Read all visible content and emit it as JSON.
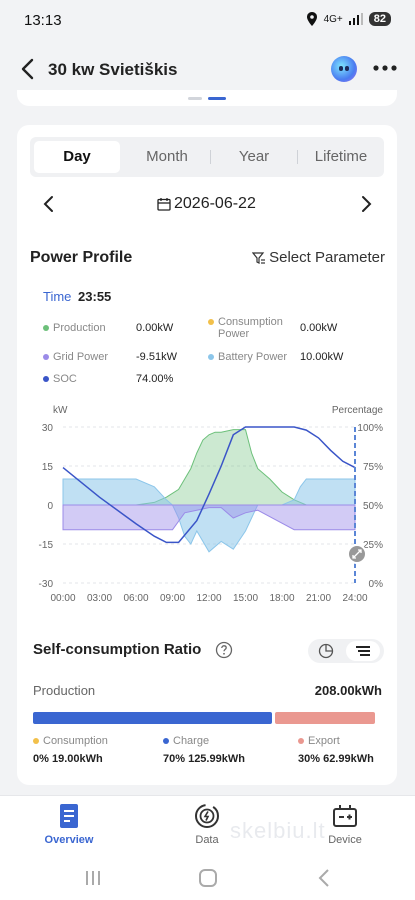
{
  "status_bar": {
    "time": "13:13",
    "network": "4G+",
    "battery": "82"
  },
  "header": {
    "title": "30 kw Svietiškis"
  },
  "tabs": [
    {
      "label": "Day",
      "active": true
    },
    {
      "label": "Month",
      "active": false
    },
    {
      "label": "Year",
      "active": false
    },
    {
      "label": "Lifetime",
      "active": false
    }
  ],
  "date": "2026-06-22",
  "power_profile": {
    "title": "Power Profile",
    "select_parameter": "Select Parameter",
    "time_label": "Time",
    "time_value": "23:55",
    "readouts": [
      {
        "label": "Production",
        "value": "0.00kW",
        "color": "#6cc07a"
      },
      {
        "label": "Consumption Power",
        "value": "0.00kW",
        "color": "#f2c04a"
      },
      {
        "label": "Grid Power",
        "value": "-9.51kW",
        "color": "#9b8be8"
      },
      {
        "label": "Battery Power",
        "value": "10.00kW",
        "color": "#8cc6ea"
      },
      {
        "label": "SOC",
        "value": "74.00%",
        "color": "#3a55c8"
      }
    ]
  },
  "chart_data": {
    "type": "area",
    "y_left_label": "kW",
    "y_right_label": "Percentage",
    "y_left_ticks": [
      "30",
      "15",
      "0",
      "-15",
      "-30"
    ],
    "y_right_ticks": [
      "100%",
      "75%",
      "50%",
      "25%",
      "0%"
    ],
    "ylim_left": [
      -30,
      30
    ],
    "ylim_right": [
      0,
      100
    ],
    "x_ticks": [
      "00:00",
      "03:00",
      "06:00",
      "09:00",
      "12:00",
      "15:00",
      "18:00",
      "21:00",
      "24:00"
    ],
    "grid": true,
    "series": [
      {
        "name": "Production",
        "color": "#6cc07a",
        "x": [
          0,
          6,
          7.5,
          8.5,
          9.5,
          10,
          10.5,
          11,
          11.5,
          12,
          12.5,
          13,
          14,
          15,
          15.5,
          16,
          17,
          18,
          19,
          20,
          24
        ],
        "y": [
          0,
          0,
          1,
          3,
          6,
          10,
          14,
          20,
          25,
          27,
          28,
          28,
          29,
          29,
          20,
          14,
          10,
          5,
          2,
          0,
          0
        ]
      },
      {
        "name": "Battery Power",
        "color": "#8cc6ea",
        "x": [
          0,
          6,
          7.5,
          8.5,
          9,
          9.5,
          10,
          10.5,
          11,
          12,
          13,
          14,
          15,
          15.5,
          16,
          18,
          19,
          19.5,
          20,
          24
        ],
        "y": [
          10,
          10,
          7,
          2,
          0,
          -5,
          -12,
          -15,
          -10,
          -18,
          -14,
          -17,
          -10,
          -5,
          0,
          0,
          2,
          7,
          10,
          10
        ]
      },
      {
        "name": "Grid Power",
        "color": "#9b8be8",
        "x": [
          0,
          9,
          10,
          11,
          12,
          13,
          14,
          15,
          16,
          19,
          24
        ],
        "y": [
          -9.5,
          -9.5,
          -3,
          -2,
          -1,
          -1,
          -5,
          -3,
          -2,
          -9.5,
          -9.5
        ]
      },
      {
        "name": "SOC",
        "color": "#3a55c8",
        "axis": "right",
        "x": [
          0,
          3,
          6,
          7.5,
          8.5,
          9.5,
          11,
          12,
          13,
          14,
          15,
          16,
          17,
          18,
          19,
          20,
          21,
          22,
          23,
          24
        ],
        "y": [
          74,
          55,
          38,
          30,
          26,
          26,
          40,
          57,
          75,
          95,
          100,
          100,
          100,
          100,
          100,
          98,
          93,
          85,
          78,
          74
        ]
      }
    ]
  },
  "self_consumption": {
    "title": "Self-consumption Ratio",
    "production_label": "Production",
    "production_value": "208.00kWh",
    "charge_fraction": 0.7,
    "export_fraction": 0.3,
    "breakdown": [
      {
        "label": "Consumption",
        "value": "0% 19.00kWh",
        "color": "#f2c04a"
      },
      {
        "label": "Charge",
        "value": "70% 125.99kWh",
        "color": "#3a66d1"
      },
      {
        "label": "Export",
        "value": "30% 62.99kWh",
        "color": "#ea9890"
      }
    ]
  },
  "bottom_nav": [
    {
      "label": "Overview",
      "active": true
    },
    {
      "label": "Data",
      "active": false
    },
    {
      "label": "Device",
      "active": false
    }
  ],
  "watermark": "skelbiu.lt"
}
